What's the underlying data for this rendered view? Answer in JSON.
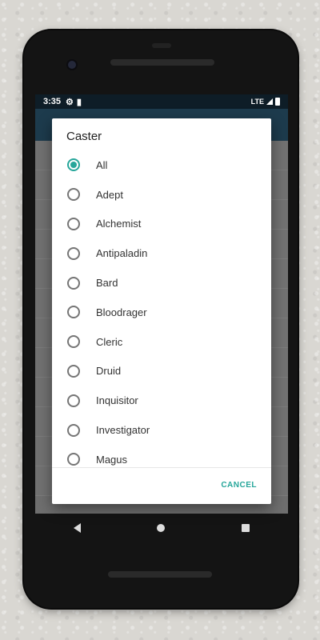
{
  "statusbar": {
    "time": "3:35",
    "network": "LTE"
  },
  "dialog": {
    "title": "Caster",
    "options": [
      {
        "label": "All",
        "checked": true
      },
      {
        "label": "Adept",
        "checked": false
      },
      {
        "label": "Alchemist",
        "checked": false
      },
      {
        "label": "Antipaladin",
        "checked": false
      },
      {
        "label": "Bard",
        "checked": false
      },
      {
        "label": "Bloodrager",
        "checked": false
      },
      {
        "label": "Cleric",
        "checked": false
      },
      {
        "label": "Druid",
        "checked": false
      },
      {
        "label": "Inquisitor",
        "checked": false
      },
      {
        "label": "Investigator",
        "checked": false
      },
      {
        "label": "Magus",
        "checked": false
      }
    ],
    "cancel_label": "CANCEL"
  },
  "colors": {
    "accent": "#26a69a",
    "statusbar": "#0e1d27",
    "toolbar": "#1d3b4d"
  }
}
